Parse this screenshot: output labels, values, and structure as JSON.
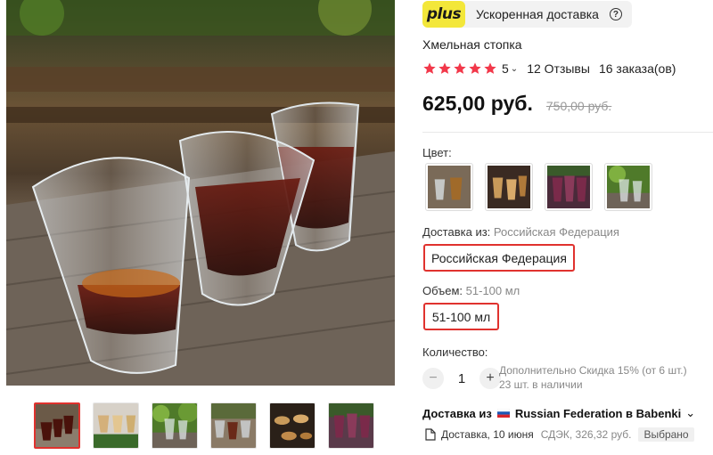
{
  "plus_bar": {
    "logo": "plus",
    "text": "Ускоренная доставка",
    "help": "?"
  },
  "product": {
    "title": "Хмельная стопка",
    "rating": "5",
    "stars_count": 5,
    "reviews": "12 Отзывы",
    "orders": "16 заказа(ов)",
    "price": "625,00 руб.",
    "old_price": "750,00 руб."
  },
  "color": {
    "label": "Цвет:",
    "options": [
      "Вариант 1",
      "Вариант 2",
      "Вариант 3",
      "Вариант 4"
    ]
  },
  "ship_from": {
    "label": "Доставка из:",
    "value": "Российская Федерация",
    "selected": "Российская Федерация"
  },
  "volume": {
    "label": "Объем:",
    "value": "51-100 мл",
    "selected": "51-100 мл"
  },
  "quantity": {
    "label": "Количество:",
    "value": "1",
    "minus": "−",
    "plus": "+",
    "discount": "Дополнительно Скидка 15% (от 6 шт.)",
    "stock": "23 шт. в наличии"
  },
  "delivery": {
    "from_prefix": "Доставка из",
    "route": "Russian Federation в Babenki",
    "chevron": "⌄",
    "date": "Доставка, 10 июня",
    "carrier": "СДЭК, 326,32 руб.",
    "chosen": "Выбрано"
  },
  "colors": {
    "accent": "#e0322e",
    "plus_yellow": "#f3e73a",
    "star": "#f2384a"
  },
  "gallery": {
    "thumb_count": 6,
    "active_index": 0
  }
}
